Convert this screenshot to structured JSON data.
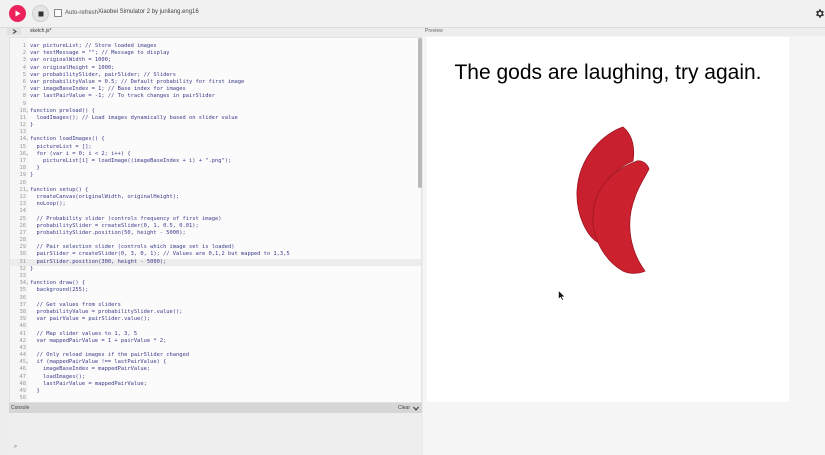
{
  "toolbar": {
    "autorefresh_label": "Auto-refresh",
    "autorefresh_checked": false,
    "sketch_title": "Xiaobei Simulator 2 by junliang.eng16"
  },
  "editor": {
    "file_name": "sketch.js*",
    "code_lines": [
      "var pictureList; // Store loaded images",
      "var textMessage = \"\"; // Message to display",
      "var originalWidth = 1000;",
      "var originalHeight = 1000;",
      "var probabilitySlider, pairSlider; // Sliders",
      "var probabilityValue = 0.5; // Default probability for first image",
      "var imageBaseIndex = 1; // Base index for images",
      "var lastPairValue = -1; // To track changes in pairSlider",
      "",
      "function preload() {",
      "  loadImages(); // Load images dynamically based on slider value",
      "}",
      "",
      "function loadImages() {",
      "  pictureList = [];",
      "  for (var i = 0; i < 2; i++) {",
      "    pictureList[i] = loadImage((imageBaseIndex + i) + \".png\");",
      "  }",
      "}",
      "",
      "function setup() {",
      "  createCanvas(originalWidth, originalHeight);",
      "  noLoop();",
      "",
      "  // Probability slider (controls frequency of first image)",
      "  probabilitySlider = createSlider(0, 1, 0.5, 0.01);",
      "  probabilitySlider.position(50, height - 5000);",
      "",
      "  // Pair selection slider (controls which image set is loaded)",
      "  pairSlider = createSlider(0, 3, 0, 1); // Values are 0,1,2 but mapped to 1,3,5",
      "  pairSlider.position(300, height - 5000);",
      "}",
      "",
      "function draw() {",
      "  background(255);",
      "",
      "  // Get values from sliders",
      "  probabilityValue = probabilitySlider.value();",
      "  var pairValue = pairSlider.value();",
      "",
      "  // Map slider values to 1, 3, 5",
      "  var mappedPairValue = 1 + pairValue * 2;",
      "",
      "  // Only reload images if the pairSlider changed",
      "  if (mappedPairValue !== lastPairValue) {",
      "    imageBaseIndex = mappedPairValue;",
      "    loadImages();",
      "    lastPairValue = mappedPairValue;",
      "  }",
      "",
      ""
    ],
    "fold_lines": [
      10,
      14,
      16,
      21,
      34,
      45
    ],
    "highlight_line": 31
  },
  "console": {
    "label": "Console",
    "clear_label": "Clear",
    "prompt": ">"
  },
  "preview": {
    "label": "Preview",
    "canvas_message": "The gods are laughing, try again.",
    "image_name": "red-pepper-slices-image"
  },
  "colors": {
    "play_button": "#ed225d",
    "pepper_red": "#c8202e",
    "code_text": "#3b3b8a"
  }
}
